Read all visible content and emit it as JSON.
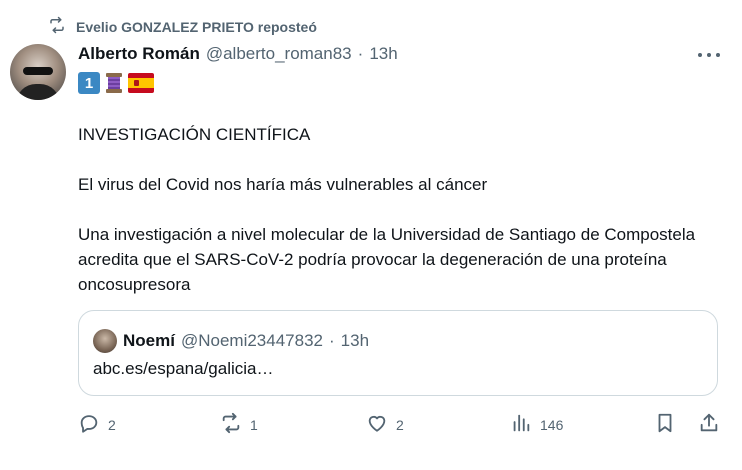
{
  "repost": {
    "text": "Evelio GONZALEZ PRIETO reposteó"
  },
  "author": {
    "name": "Alberto Román",
    "handle": "@alberto_roman83",
    "separator": "·",
    "time": "13h",
    "badges": [
      "keycap-one-emoji",
      "thread-spool-emoji",
      "spain-flag-emoji"
    ],
    "badge_one_text": "1"
  },
  "tweet": {
    "paragraphs": [
      "INVESTIGACIÓN CIENTÍFICA",
      "El virus del Covid nos haría más vulnerables al cáncer",
      "Una investigación a nivel molecular de la Universidad de Santiago de Compostela acredita que el SARS-CoV-2 podría provocar la degeneración de una proteína oncosupresora"
    ]
  },
  "quote": {
    "name": "Noemí",
    "handle": "@Noemi23447832",
    "separator": "·",
    "time": "13h",
    "text": "abc.es/espana/galicia…"
  },
  "actions": {
    "reply_count": "2",
    "repost_count": "1",
    "like_count": "2",
    "views_count": "146"
  },
  "colors": {
    "text": "#0f1419",
    "secondary": "#536471",
    "border": "#cfd9de"
  }
}
